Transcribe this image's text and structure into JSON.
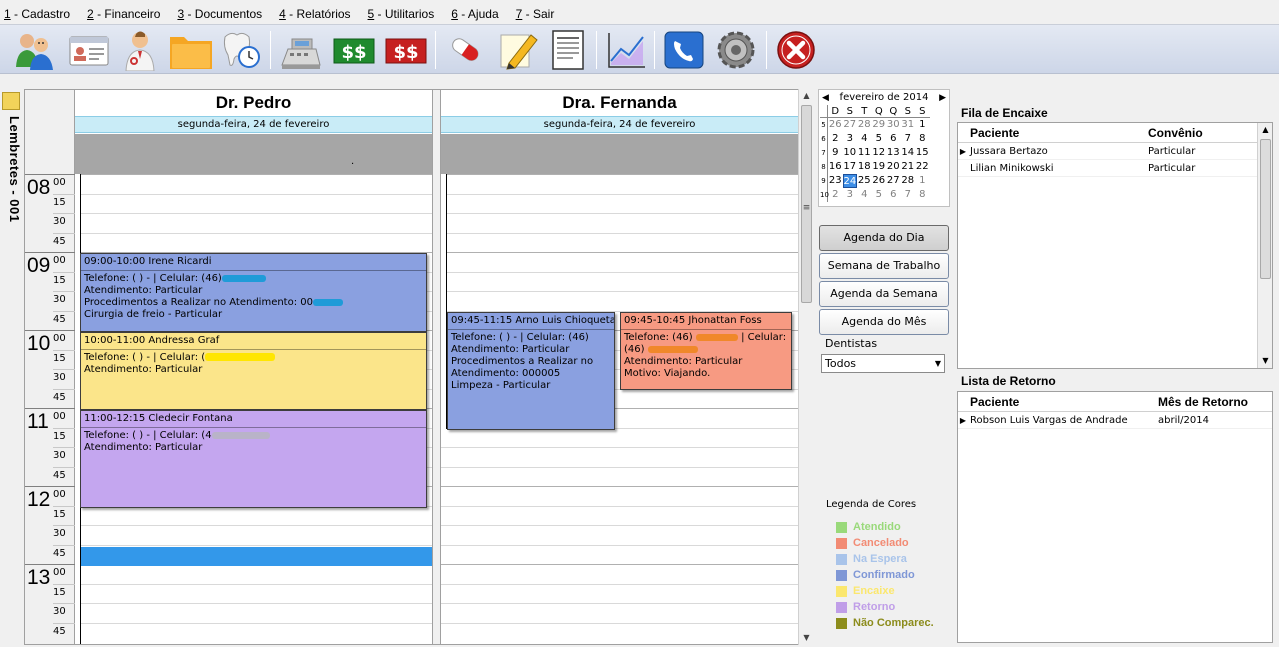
{
  "menu": [
    {
      "key": "1",
      "label": " - Cadastro"
    },
    {
      "key": "2",
      "label": " - Financeiro"
    },
    {
      "key": "3",
      "label": " - Documentos"
    },
    {
      "key": "4",
      "label": " - Relatórios"
    },
    {
      "key": "5",
      "label": " - Utilitarios"
    },
    {
      "key": "6",
      "label": " - Ajuda"
    },
    {
      "key": "7",
      "label": " - Sair"
    }
  ],
  "toolbar_icons": [
    "patients-icon",
    "id-card-icon",
    "doctor-icon",
    "folder-icon",
    "tooth-clock-icon",
    "cash-register-icon",
    "money-in-icon",
    "money-out-icon",
    "pills-icon",
    "pencil-icon",
    "document-icon",
    "chart-icon",
    "phone-icon",
    "settings-gear-icon",
    "exit-icon"
  ],
  "reminders": {
    "label": "Lembretes - 001"
  },
  "scheduler": {
    "hours": [
      "08",
      "09",
      "10",
      "11",
      "12",
      "13"
    ],
    "minutes": [
      "00",
      "15",
      "30",
      "45"
    ],
    "dentists": [
      {
        "name": "Dr. Pedro",
        "date": "segunda-feira, 24 de fevereiro",
        "allday_mark": ".",
        "appointments": [
          {
            "title": "09:00-10:00 Irene Ricardi",
            "phone": "Telefone: (  )     -       | Celular: (46)",
            "attendance": "Atendimento: Particular",
            "procedures": "Procedimentos a Realizar no Atendimento: 00",
            "extra": "Cirurgia de freio - Particular",
            "color": "#8aa0e0"
          },
          {
            "title": "10:00-11:00 Andressa Graf",
            "phone": "Telefone: (  )     -       | Celular: (",
            "attendance": "Atendimento: Particular",
            "color": "#fbe58a"
          },
          {
            "title": "11:00-12:15 Cledecir Fontana",
            "phone": "Telefone: (  )     -       | Celular: (4",
            "attendance": "Atendimento: Particular",
            "color": "#c4a6ef"
          }
        ]
      },
      {
        "name": "Dra. Fernanda",
        "date": "segunda-feira, 24 de fevereiro",
        "appointments": [
          {
            "title": "09:45-11:15 Arno Luis Chioqueta",
            "phone": "Telefone: (  )     -       | Celular: (46)",
            "attendance": "Atendimento: Particular",
            "procedures": "Procedimentos a Realizar no Atendimento: 000005",
            "extra": "Limpeza - Particular",
            "color": "#8aa0e0"
          },
          {
            "title": "09:45-10:45 Jhonattan Foss",
            "phone": "Telefone: (46)",
            "phone_tail": "| Celular:",
            "phone2": "(46)",
            "attendance": "Atendimento: Particular",
            "reason": "Motivo: Viajando.",
            "color": "#f79a82"
          }
        ]
      }
    ]
  },
  "calendar": {
    "month": "fevereiro de 2014",
    "weekdays": [
      "D",
      "S",
      "T",
      "Q",
      "Q",
      "S",
      "S"
    ],
    "weeks": [
      {
        "wk": "5",
        "days": [
          "26",
          "27",
          "28",
          "29",
          "30",
          "31",
          "1"
        ]
      },
      {
        "wk": "6",
        "days": [
          "2",
          "3",
          "4",
          "5",
          "6",
          "7",
          "8"
        ]
      },
      {
        "wk": "7",
        "days": [
          "9",
          "10",
          "11",
          "12",
          "13",
          "14",
          "15"
        ]
      },
      {
        "wk": "8",
        "days": [
          "16",
          "17",
          "18",
          "19",
          "20",
          "21",
          "22"
        ]
      },
      {
        "wk": "9",
        "days": [
          "23",
          "24",
          "25",
          "26",
          "27",
          "28",
          "1"
        ]
      },
      {
        "wk": "10",
        "days": [
          "2",
          "3",
          "4",
          "5",
          "6",
          "7",
          "8"
        ]
      }
    ],
    "selected": "24"
  },
  "views": [
    "Agenda do Dia",
    "Semana de Trabalho",
    "Agenda da Semana",
    "Agenda do Mês"
  ],
  "dentists_filter": {
    "label": "Dentistas",
    "value": "Todos"
  },
  "legend": {
    "title": "Legenda de Cores",
    "items": [
      {
        "label": "Atendido",
        "color": "#99d97a"
      },
      {
        "label": "Cancelado",
        "color": "#f28b74"
      },
      {
        "label": "Na Espera",
        "color": "#a9c4ea"
      },
      {
        "label": "Confirmado",
        "color": "#7f97d6"
      },
      {
        "label": "Encaixe",
        "color": "#fbe76e"
      },
      {
        "label": "Retorno",
        "color": "#c09ee8"
      },
      {
        "label": "Não Comparec.",
        "color": "#8c8c1c"
      }
    ]
  },
  "fila": {
    "title": "Fila de Encaixe",
    "columns": [
      "Paciente",
      "Convênio"
    ],
    "rows": [
      {
        "paciente": "Jussara Bertazo",
        "convenio": "Particular",
        "current": true
      },
      {
        "paciente": "Lilian Minikowski",
        "convenio": "Particular",
        "current": false
      }
    ]
  },
  "retorno": {
    "title": "Lista de Retorno",
    "columns": [
      "Paciente",
      "Mês de Retorno"
    ],
    "rows": [
      {
        "paciente": "Robson Luis Vargas de Andrade",
        "mes": "abril/2014",
        "current": true
      }
    ]
  }
}
